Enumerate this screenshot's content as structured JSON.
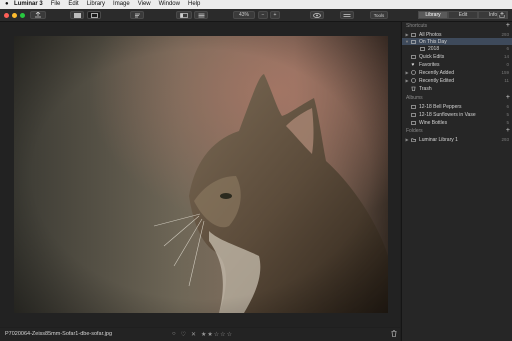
{
  "menu": {
    "app": "Luminar 3",
    "items": [
      "File",
      "Edit",
      "Library",
      "Image",
      "View",
      "Window",
      "Help"
    ]
  },
  "toolbar": {
    "zoom": "43%",
    "zoom_minus": "−",
    "zoom_plus": "+",
    "tools_label": "Tools",
    "tabs": [
      "Library",
      "Edit",
      "Info"
    ],
    "active_tab": "Library"
  },
  "sidebar": {
    "shortcuts_title": "Shortcuts",
    "shortcuts": [
      {
        "label": "All Photos",
        "count": "293"
      },
      {
        "label": "On This Day",
        "count": "",
        "selected": true
      },
      {
        "label": "2018",
        "count": "6",
        "indent": true
      },
      {
        "label": "Quick Edits",
        "count": "14"
      },
      {
        "label": "Favorites",
        "count": "0"
      },
      {
        "label": "Recently Added",
        "count": "159"
      },
      {
        "label": "Recently Edited",
        "count": "11"
      },
      {
        "label": "Trash",
        "count": ""
      }
    ],
    "albums_title": "Albums",
    "albums": [
      {
        "label": "12-18 Bell Peppers",
        "count": "6"
      },
      {
        "label": "12-18 Sunflowers in Vase",
        "count": "5"
      },
      {
        "label": "Wine Bottles",
        "count": "5"
      }
    ],
    "folders_title": "Folders",
    "folders": [
      {
        "label": "Luminar Library 1",
        "count": "293"
      }
    ]
  },
  "bottom": {
    "filename": "P7020064-Zeiss85mm-Sofar1-dbe-sofar.jpg",
    "rating_stars": 2,
    "rating_max": 5
  },
  "colors": {
    "selection": "#3e4a5b",
    "close": "#fe5f57",
    "minimize": "#febc2e",
    "zoom": "#28c840"
  }
}
